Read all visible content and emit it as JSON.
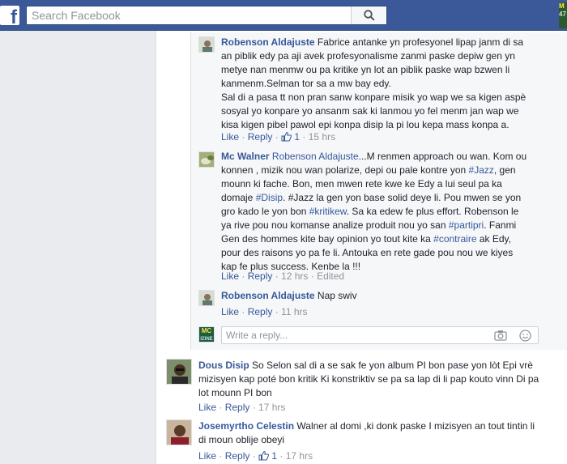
{
  "header": {
    "logo_letter": "f",
    "search_placeholder": "Search Facebook",
    "top_thumb_text": "M",
    "top_thumb_sub": "47"
  },
  "comments": {
    "r1": {
      "author": "Robenson Aldajuste",
      "line1": "Fabrice antanke yn profesyonel lipap janm di sa",
      "line2": "an piblik edy pa aji avek profesyonalisme zanmi paske depiw gen yn",
      "line3": "metye nan menmw ou pa kritike yn lot an piblik paske wap bzwen li",
      "line4": "kanmenm.Selman tor sa a mw bay edy.",
      "line5": "Sal di a pasa tt non pran sanw konpare misik yo wap we sa kigen aspè",
      "line6": "sosyal yo konpare yo ansanm sak ki lanmou yo fel menm jan wap we",
      "line7": "kisa kigen pibel pawol epi konpa disip la pi lou kepa mass konpa a.",
      "like": "Like",
      "reply": "Reply",
      "reactions": "1",
      "time": "15 hrs"
    },
    "mc": {
      "author": "Mc Walner",
      "l1_mention": "Robenson Aldajuste",
      "l1_text": "...M renmen approach ou wan. Kom ou",
      "l2_a": "konnen , mizik nou wan polarize, depi ou pale kontre yon ",
      "l2_tag": "#Jazz",
      "l2_b": ", gen",
      "l3": "mounn ki fache. Bon, men mwen rete kwe ke Edy a lui seul pa ka",
      "l4_a": "domaje ",
      "l4_tag": "#Disip",
      "l4_b": ". #Jazz la gen yon base solid deye li. Pou mwen se yon",
      "l5_a": "gro kado le yon bon ",
      "l5_tag": "#kritikew",
      "l5_b": ". Sa ka edew fe plus effort. Robenson le",
      "l6_a": "ya rive pou nou komanse analize produit nou yo san ",
      "l6_tag": "#partipri",
      "l6_b": ". Fanmi",
      "l7_a": "Gen des hommes kite bay opinion yo tout kite ka ",
      "l7_tag": "#contraire",
      "l7_b": " ak Edy,",
      "l8": "pour des raisons yo pa fe li. Antouka en rete gade pou nou we kiyes",
      "l9": "kap fe plus success. Kenbe la !!!",
      "like": "Like",
      "reply": "Reply",
      "time": "12 hrs",
      "edited": "Edited"
    },
    "r2": {
      "author": "Robenson Aldajuste",
      "text": "Nap swiv",
      "like": "Like",
      "reply": "Reply",
      "time": "11 hrs"
    },
    "reply_box": {
      "placeholder": "Write a reply...",
      "avatar_text": "MC",
      "avatar_sub": "IZINE"
    },
    "dous": {
      "author": "Dous Disip",
      "l1": "So Selon sal di a se sak fe yon album PI bon pase yon lòt Epi vrè",
      "l2": "mizisyen kap poté bon kritik Ki konstriktiv se pa sa lap di li pap kouto vinn Di pa",
      "l3": "lot mounn PI bon",
      "like": "Like",
      "reply": "Reply",
      "time": "17 hrs"
    },
    "jose": {
      "author": "Josemyrtho Celestin",
      "l1": "Walner al domi ,ki donk paske I mizisyen an tout tintin li",
      "l2": "di moun oblije obeyi",
      "like": "Like",
      "reply": "Reply",
      "reactions": "1",
      "time": "17 hrs"
    }
  }
}
